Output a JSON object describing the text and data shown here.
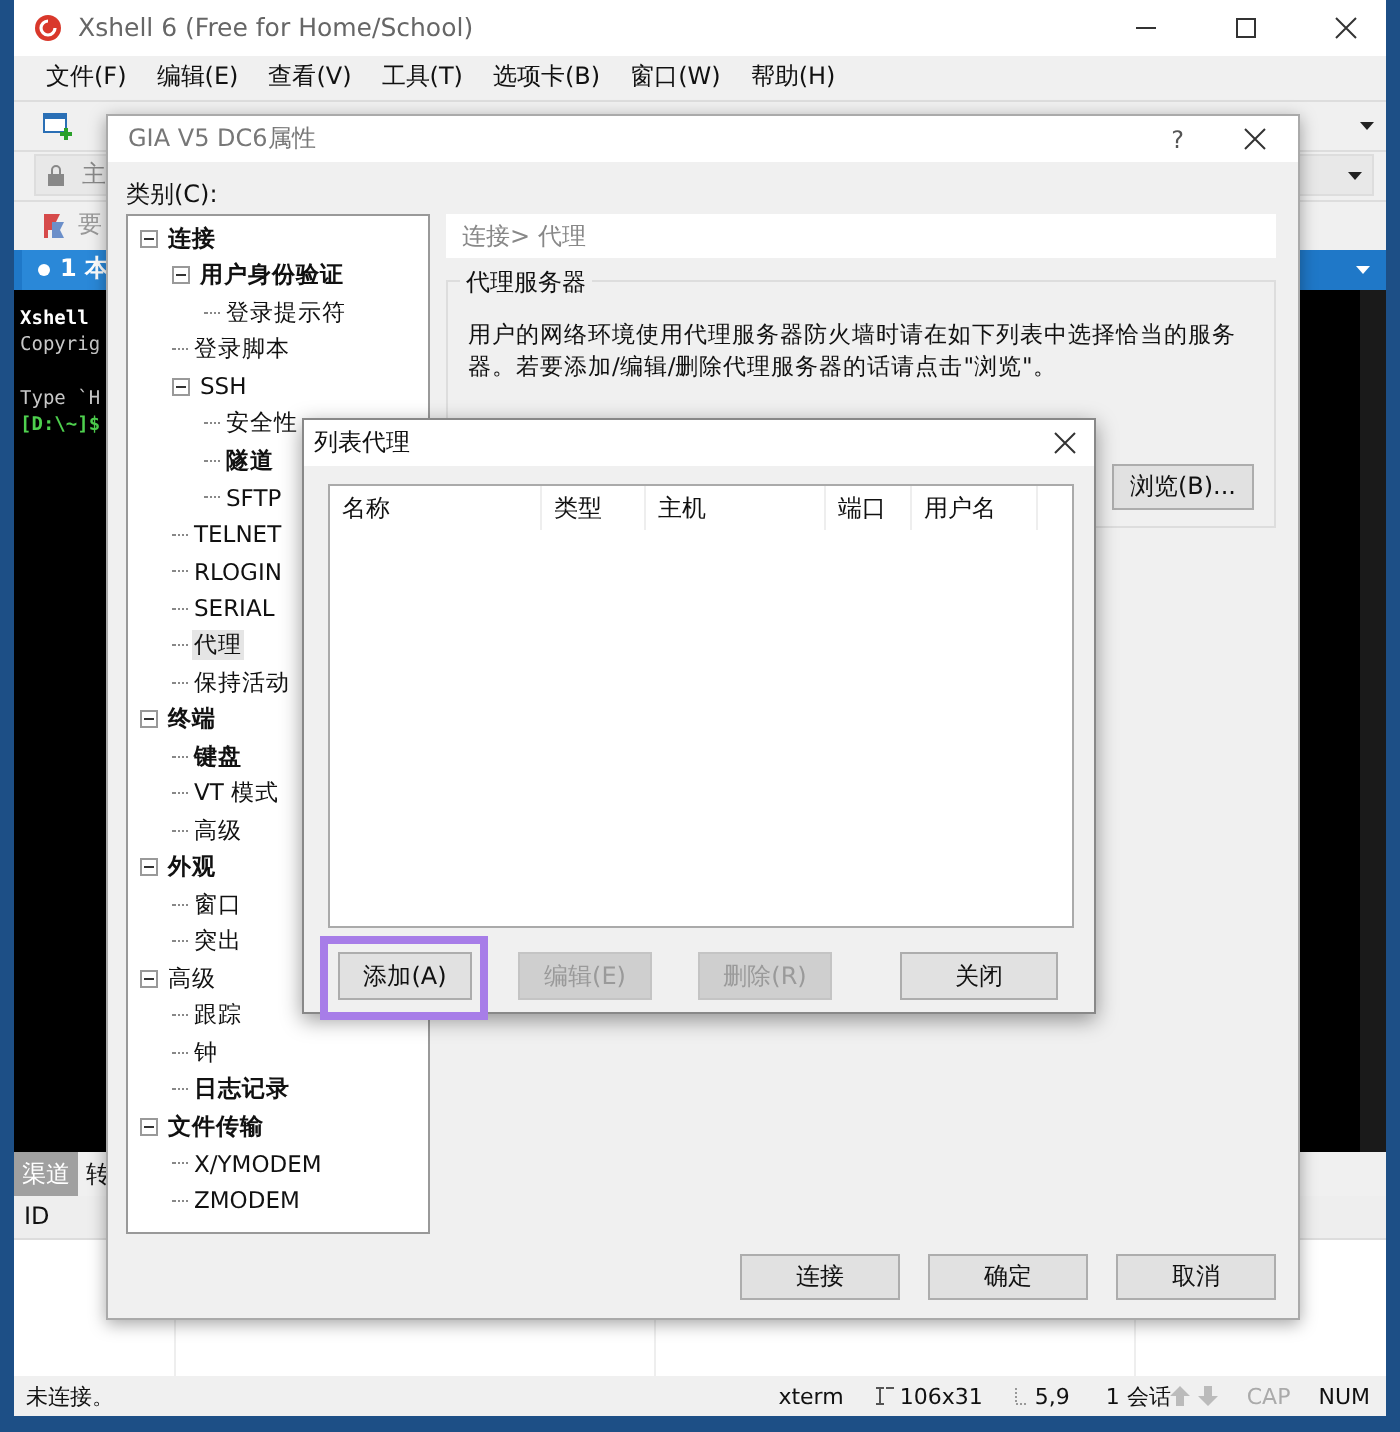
{
  "app_window": {
    "title": "Xshell 6 (Free for Home/School)",
    "menu": [
      "文件(F)",
      "编辑(E)",
      "查看(V)",
      "工具(T)",
      "选项卡(B)",
      "窗口(W)",
      "帮助(H)"
    ],
    "address_text": "主",
    "links_text": "要",
    "session_tab": {
      "label": "1 本",
      "selected": true
    },
    "terminal_lines": [
      {
        "text": "Xshell",
        "kind": "bold"
      },
      {
        "text": "Copyrig",
        "kind": "plain"
      },
      {
        "text": "Type `H",
        "kind": "plain"
      },
      {
        "text": "[D:\\~]$",
        "kind": "prompt"
      }
    ],
    "bottom_tabs": [
      {
        "label": "渠道",
        "selected": true
      },
      {
        "label": "转",
        "selected": false
      }
    ],
    "bottom_columns": [
      "ID"
    ],
    "status_bar": {
      "text": "未连接。",
      "terminal_type": "xterm",
      "size": "106x31",
      "cursor": "5,9",
      "sessions": "1 会话",
      "indicators": [
        {
          "label": "CAP",
          "on": false
        },
        {
          "label": "NUM",
          "on": true
        }
      ]
    }
  },
  "properties_dialog": {
    "title": "GIA V5 DC6属性",
    "help": "?",
    "category_label": "类别(C):",
    "tree": [
      {
        "label": "连接",
        "bold": true,
        "selected": false,
        "children": [
          {
            "label": "用户身份验证",
            "bold": true,
            "selected": false,
            "children": [
              {
                "label": "登录提示符",
                "bold": false,
                "selected": false
              }
            ]
          },
          {
            "label": "登录脚本",
            "bold": false,
            "selected": false
          },
          {
            "label": "SSH",
            "bold": false,
            "selected": false,
            "children": [
              {
                "label": "安全性",
                "bold": false,
                "selected": false
              },
              {
                "label": "隧道",
                "bold": true,
                "selected": false
              },
              {
                "label": "SFTP",
                "bold": false,
                "selected": false
              }
            ]
          },
          {
            "label": "TELNET",
            "bold": false,
            "selected": false
          },
          {
            "label": "RLOGIN",
            "bold": false,
            "selected": false
          },
          {
            "label": "SERIAL",
            "bold": false,
            "selected": false
          },
          {
            "label": "代理",
            "bold": false,
            "selected": true
          },
          {
            "label": "保持活动",
            "bold": false,
            "selected": false
          }
        ]
      },
      {
        "label": "终端",
        "bold": true,
        "selected": false,
        "children": [
          {
            "label": "键盘",
            "bold": true,
            "selected": false
          },
          {
            "label": "VT 模式",
            "bold": false,
            "selected": false
          },
          {
            "label": "高级",
            "bold": false,
            "selected": false
          }
        ]
      },
      {
        "label": "外观",
        "bold": true,
        "selected": false,
        "children": [
          {
            "label": "窗口",
            "bold": false,
            "selected": false
          },
          {
            "label": "突出",
            "bold": false,
            "selected": false
          }
        ]
      },
      {
        "label": "高级",
        "bold": false,
        "selected": false,
        "children": [
          {
            "label": "跟踪",
            "bold": false,
            "selected": false
          },
          {
            "label": "钟",
            "bold": false,
            "selected": false
          },
          {
            "label": "日志记录",
            "bold": true,
            "selected": false
          }
        ]
      },
      {
        "label": "文件传输",
        "bold": true,
        "selected": false,
        "children": [
          {
            "label": "X/YMODEM",
            "bold": false,
            "selected": false
          },
          {
            "label": "ZMODEM",
            "bold": false,
            "selected": false
          }
        ]
      }
    ],
    "breadcrumb": "连接> 代理",
    "group": {
      "title": "代理服务器",
      "description": "用户的网络环境使用代理服务器防火墙时请在如下列表中选择恰当的服务器。若要添加/编辑/删除代理服务器的话请点击\"浏览\"。",
      "browse_button": "浏览(B)..."
    },
    "buttons": [
      "连接",
      "确定",
      "取消"
    ]
  },
  "list_dialog": {
    "title": "列表代理",
    "columns": [
      "名称",
      "类型",
      "主机",
      "端口",
      "用户名"
    ],
    "buttons": [
      {
        "label": "添加(A)",
        "disabled": false,
        "highlighted": true
      },
      {
        "label": "编辑(E)",
        "disabled": true,
        "highlighted": false
      },
      {
        "label": "删除(R)",
        "disabled": true,
        "highlighted": false
      },
      {
        "label": "关闭",
        "disabled": false,
        "highlighted": false
      }
    ]
  }
}
